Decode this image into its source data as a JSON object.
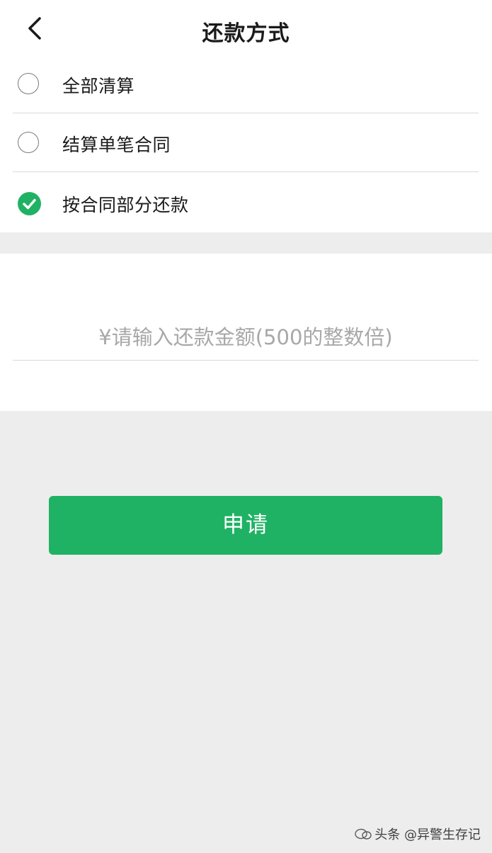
{
  "header": {
    "title": "还款方式",
    "back_icon": "chevron-left-icon"
  },
  "options": [
    {
      "label": "全部清算",
      "checked": false
    },
    {
      "label": "结算单笔合同",
      "checked": false
    },
    {
      "label": "按合同部分还款",
      "checked": true
    }
  ],
  "amount": {
    "placeholder": "¥请输入还款金额(500的整数倍)",
    "value": ""
  },
  "submit": {
    "label": "申请"
  },
  "watermark": {
    "text": "头条 @异警生存记"
  },
  "colors": {
    "accent": "#1fb264",
    "background": "#ededed",
    "surface": "#ffffff",
    "divider": "#d9d9d9",
    "placeholder": "#a8a8a8"
  }
}
